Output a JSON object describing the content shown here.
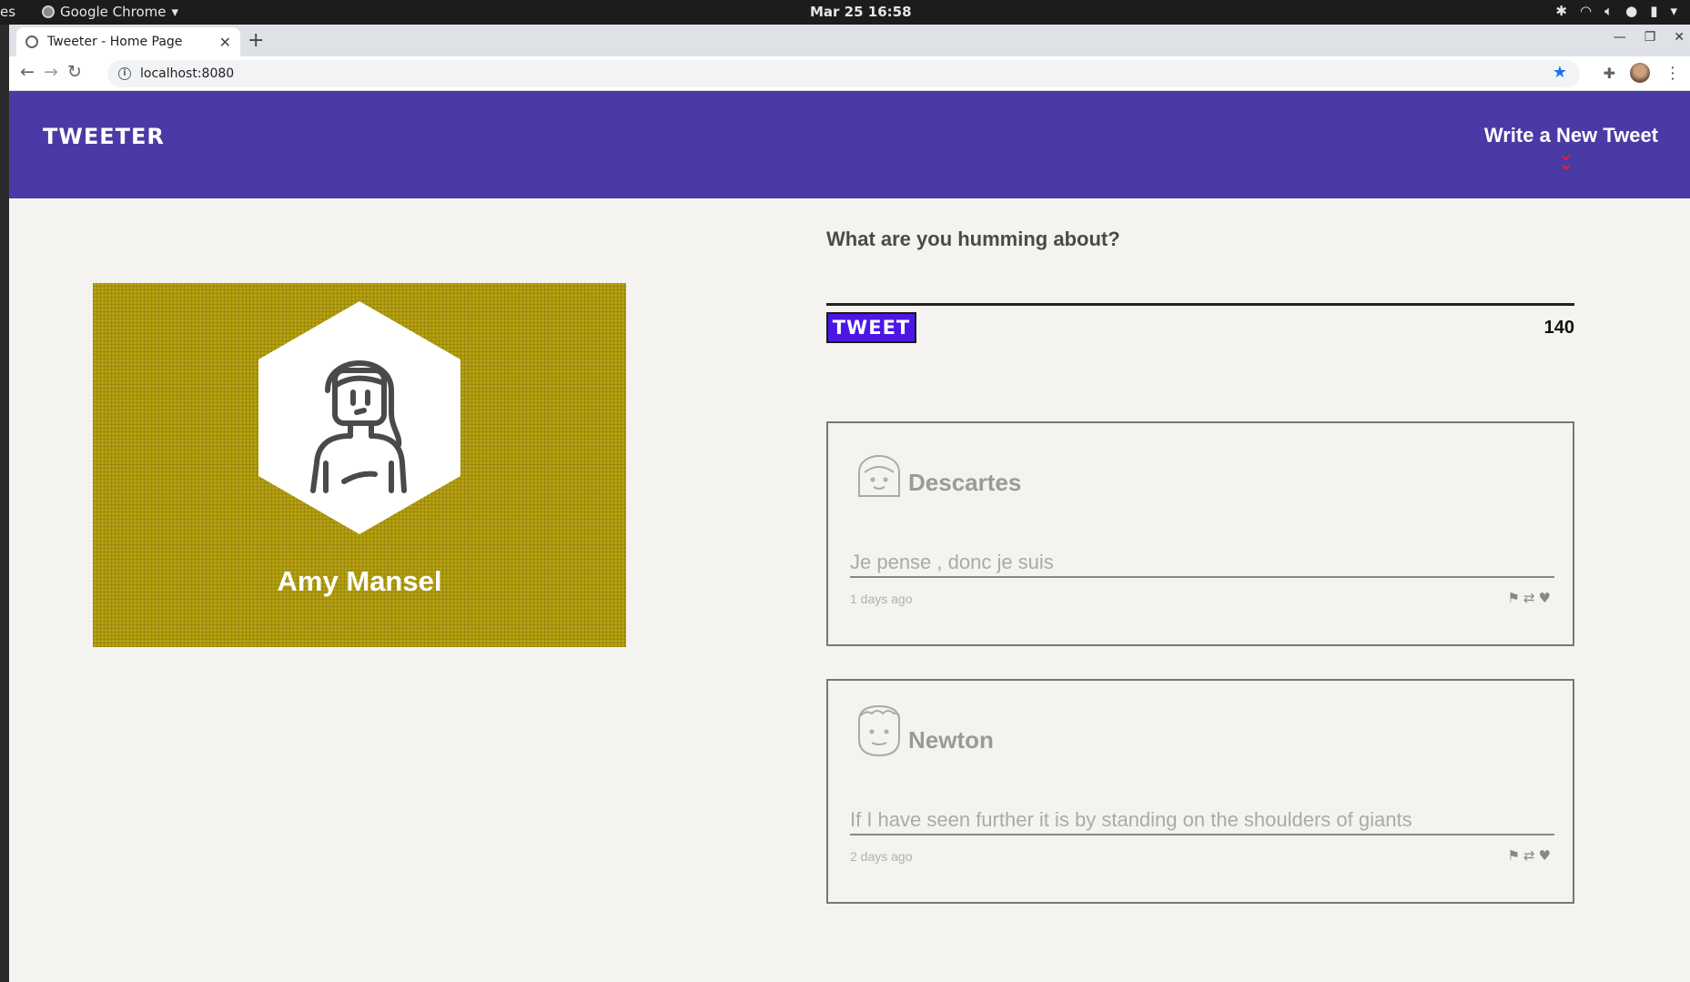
{
  "os": {
    "left_fragment": "es",
    "app_name": "Google Chrome",
    "clock": "Mar 25  16:58"
  },
  "browser": {
    "tab_title": "Tweeter - Home Page",
    "url": "localhost:8080"
  },
  "nav": {
    "brand": "TWEETER",
    "compose_link": "Write a New Tweet"
  },
  "profile": {
    "name": "Amy Mansel"
  },
  "composer": {
    "label": "What are you humming about?",
    "input_value": "",
    "button_label": "TWEET",
    "counter": "140"
  },
  "tweets": [
    {
      "author": "Descartes",
      "text": "Je pense , donc je suis",
      "time": "1 days ago"
    },
    {
      "author": "Newton",
      "text": "If I have seen further it is by standing on the shoulders of giants",
      "time": "2 days ago"
    }
  ],
  "colors": {
    "nav_bg": "#4a3aa5",
    "profile_bg": "#b6a010",
    "tweet_button": "#4b16e6",
    "arrow": "#e8202a"
  }
}
